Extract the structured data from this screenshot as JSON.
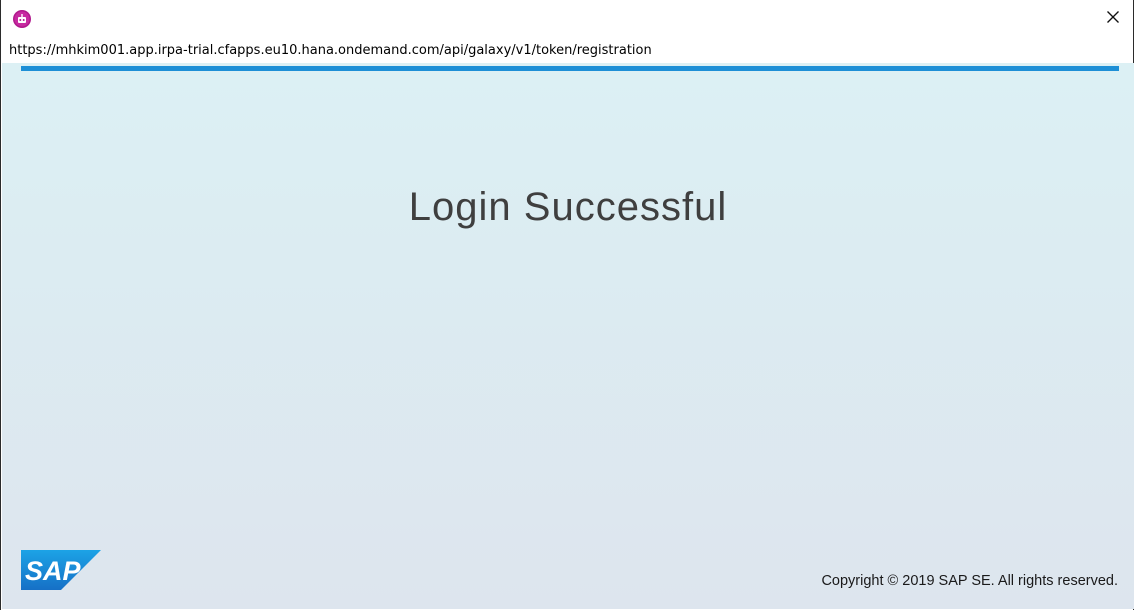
{
  "window": {
    "app_icon": "sap-irpa-agent-icon",
    "close_icon": "close-icon"
  },
  "address_bar": {
    "url": "https://mhkim001.app.irpa-trial.cfapps.eu10.hana.ondemand.com/api/galaxy/v1/token/registration"
  },
  "page": {
    "headline": "Login Successful",
    "logo_text": "SAP",
    "copyright": "Copyright © 2019 SAP SE. All rights reserved."
  },
  "colors": {
    "accent": "#1d8fd6",
    "logo_blue": "#1a7fd3",
    "headline": "#3f3f3f"
  }
}
